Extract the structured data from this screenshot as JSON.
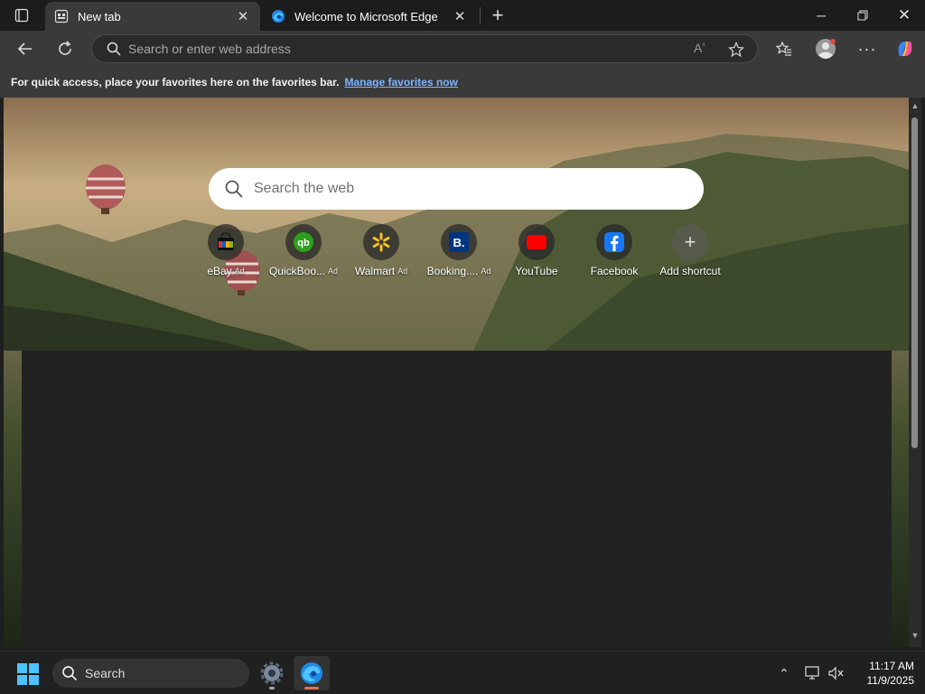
{
  "tabs": [
    {
      "title": "New tab",
      "icon": "newtab-icon",
      "active": true
    },
    {
      "title": "Welcome to Microsoft Edge",
      "icon": "edge-icon",
      "active": false
    }
  ],
  "address_bar": {
    "placeholder": "Search or enter web address",
    "value": ""
  },
  "favorites_bar": {
    "message": "For quick access, place your favorites here on the favorites bar.",
    "link": "Manage favorites now"
  },
  "newtab": {
    "search_placeholder": "Search the web",
    "shortcuts": [
      {
        "label": "eBay",
        "ad": "Ad",
        "icon": "ebay-icon"
      },
      {
        "label": "QuickBoo...",
        "ad": "Ad",
        "icon": "quickbooks-icon"
      },
      {
        "label": "Walmart",
        "ad": "Ad",
        "icon": "walmart-icon"
      },
      {
        "label": "Booking....",
        "ad": "Ad",
        "icon": "booking-icon"
      },
      {
        "label": "YouTube",
        "ad": "",
        "icon": "youtube-icon"
      },
      {
        "label": "Facebook",
        "ad": "",
        "icon": "facebook-icon"
      },
      {
        "label": "Add shortcut",
        "ad": "",
        "icon": "plus-icon"
      }
    ]
  },
  "taskbar": {
    "search_label": "Search",
    "time": "11:17 AM",
    "date": "11/9/2025"
  },
  "colors": {
    "tab_active": "#3a3a3a",
    "toolbar": "#3a3a3a",
    "link": "#7cb4ff",
    "feed_bg": "#222222"
  }
}
